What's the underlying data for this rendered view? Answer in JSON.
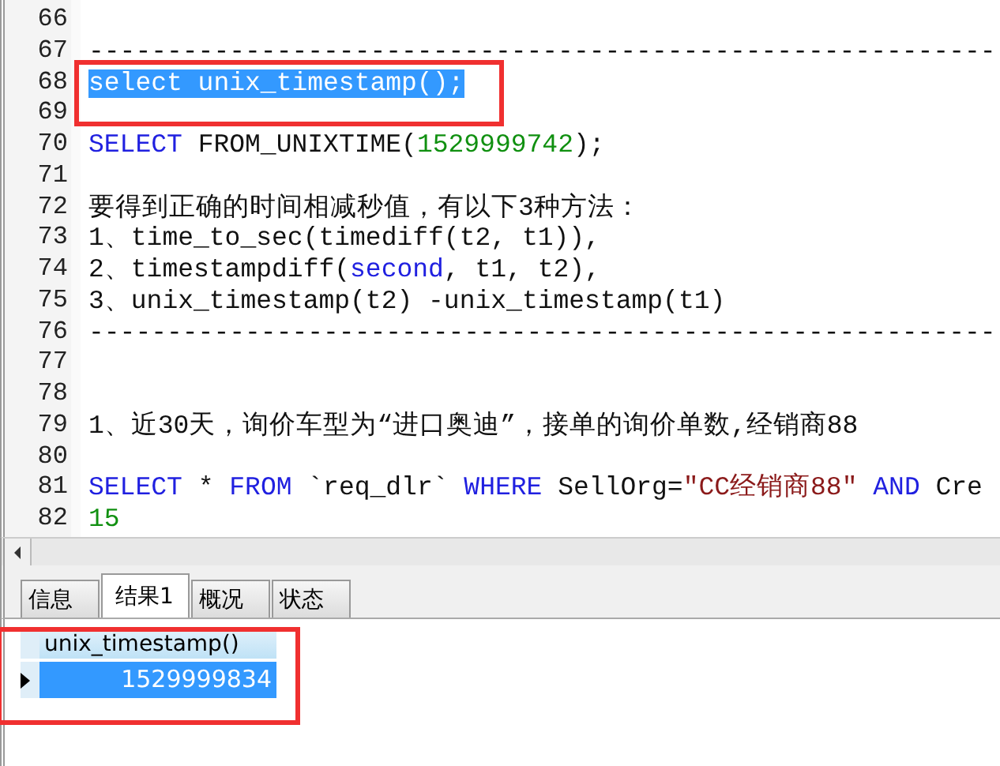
{
  "editor": {
    "lines": [
      {
        "number": "66",
        "selected": false
      },
      {
        "number": "67",
        "selected": false,
        "segments": [
          {
            "kind": "plain",
            "text": "----------------------------------------------------------"
          }
        ]
      },
      {
        "number": "68",
        "selected": true,
        "segments": [
          {
            "kind": "plain",
            "text": "select unix_timestamp();"
          }
        ]
      },
      {
        "number": "69",
        "selected": false
      },
      {
        "number": "70",
        "selected": false,
        "segments": [
          {
            "kind": "keyword",
            "text": "SELECT"
          },
          {
            "kind": "plain",
            "text": " FROM_UNIXTIME("
          },
          {
            "kind": "number",
            "text": "1529999742"
          },
          {
            "kind": "plain",
            "text": ");"
          }
        ]
      },
      {
        "number": "71",
        "selected": false
      },
      {
        "number": "72",
        "selected": false,
        "segments": [
          {
            "kind": "plain",
            "text": "要得到正确的时间相减秒值，有以下3种方法："
          }
        ]
      },
      {
        "number": "73",
        "selected": false,
        "segments": [
          {
            "kind": "plain",
            "text": "1、time_to_sec(timediff(t2, t1)),"
          }
        ]
      },
      {
        "number": "74",
        "selected": false,
        "segments": [
          {
            "kind": "plain",
            "text": "2、timestampdiff("
          },
          {
            "kind": "keyword",
            "text": "second"
          },
          {
            "kind": "plain",
            "text": ", t1, t2),"
          }
        ]
      },
      {
        "number": "75",
        "selected": false,
        "segments": [
          {
            "kind": "plain",
            "text": "3、unix_timestamp(t2) -unix_timestamp(t1)"
          }
        ]
      },
      {
        "number": "76",
        "selected": false,
        "segments": [
          {
            "kind": "plain",
            "text": "----------------------------------------------------------"
          }
        ]
      },
      {
        "number": "77",
        "selected": false
      },
      {
        "number": "78",
        "selected": false
      },
      {
        "number": "79",
        "selected": false,
        "segments": [
          {
            "kind": "plain",
            "text": "1、近30天，询价车型为“进口奥迪”，接单的询价单数,经销商88"
          }
        ]
      },
      {
        "number": "80",
        "selected": false
      },
      {
        "number": "81",
        "selected": false,
        "segments": [
          {
            "kind": "keyword",
            "text": "SELECT"
          },
          {
            "kind": "plain",
            "text": " * "
          },
          {
            "kind": "keyword",
            "text": "FROM"
          },
          {
            "kind": "plain",
            "text": " `req_dlr` "
          },
          {
            "kind": "keyword",
            "text": "WHERE"
          },
          {
            "kind": "plain",
            "text": " SellOrg="
          },
          {
            "kind": "string",
            "text": "\"CC经销商88\""
          },
          {
            "kind": "keyword",
            "text": " AND"
          },
          {
            "kind": "plain",
            "text": " Cre"
          }
        ]
      },
      {
        "number": "82",
        "selected": false,
        "segments": [
          {
            "kind": "number",
            "text": "15"
          }
        ]
      }
    ]
  },
  "tabs": [
    {
      "label": "信息",
      "selected": false
    },
    {
      "label": "结果1",
      "selected": true
    },
    {
      "label": "概况",
      "selected": false
    },
    {
      "label": "状态",
      "selected": false
    }
  ],
  "result": {
    "columns": [
      "unix_timestamp()"
    ],
    "rows": [
      {
        "selected": true,
        "cells": [
          "1529999834"
        ]
      }
    ]
  }
}
